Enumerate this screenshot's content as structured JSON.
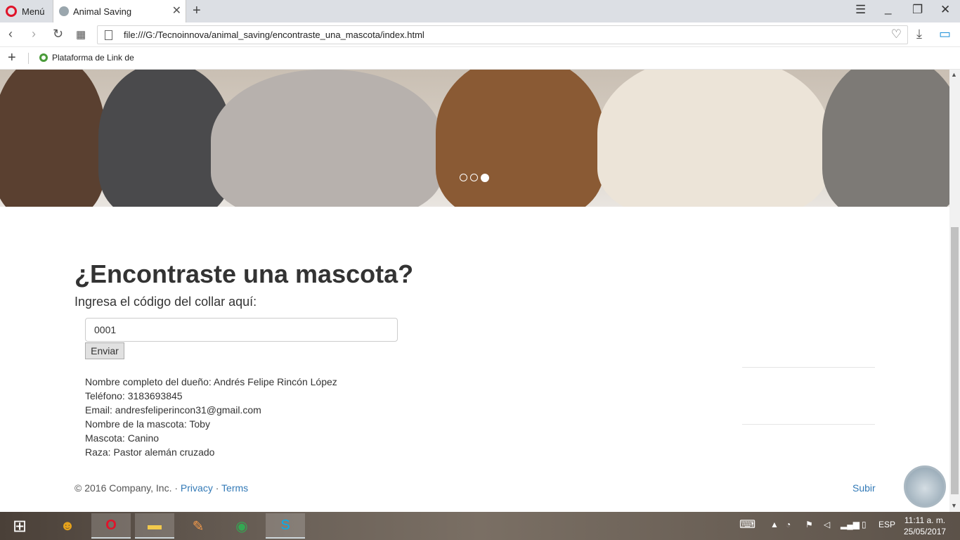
{
  "browser": {
    "menu_label": "Menú",
    "tab_title": "Animal Saving",
    "url": "file:///G:/Tecnoinnova/animal_saving/encontraste_una_mascota/index.html",
    "bookmark_label": "Plataforma de Link de"
  },
  "carousel": {
    "slide_count": 3,
    "active_slide": 3
  },
  "page": {
    "title": "¿Encontraste una mascota?",
    "subtitle": "Ingresa el código del collar aquí:",
    "code_value": "0001",
    "send_label": "Enviar",
    "owner_info": [
      "Nombre completo del dueño: Andrés Felipe Rincón López",
      "Teléfono: 3183693845",
      "Email: andresfeliperincon31@gmail.com",
      "Nombre de la mascota: Toby",
      "Mascota: Canino",
      "Raza: Pastor alemán cruzado"
    ]
  },
  "footer": {
    "copyright": "© 2016 Company, Inc.",
    "separator": "·",
    "privacy": "Privacy",
    "terms": "Terms",
    "back_to_top": "Subir"
  },
  "taskbar": {
    "language": "ESP",
    "time": "11:11 a. m.",
    "date": "25/05/2017"
  },
  "colors": {
    "link": "#337ab7",
    "opera_red": "#e0142a"
  }
}
